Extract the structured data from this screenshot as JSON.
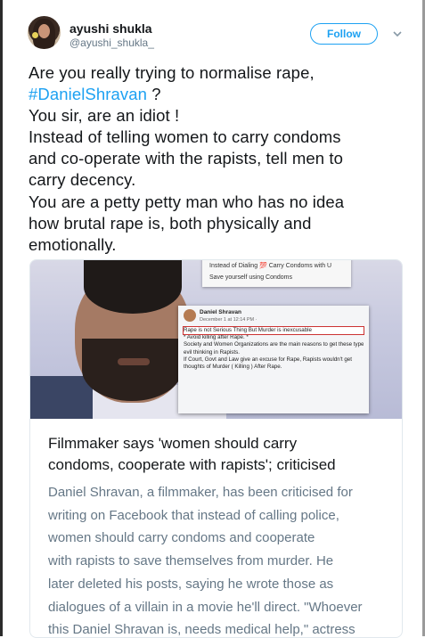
{
  "header": {
    "user_name": "ayushi shukla",
    "user_handle": "@ayushi_shukla_",
    "follow_label": "Follow",
    "menu_icon": "chevron-down-icon"
  },
  "tweet": {
    "lines": [
      "Are you really trying to normalise rape,",
      "#DanielShravan",
      " ?",
      "You sir, are an idiot !",
      "Instead of telling women to carry condoms",
      "and co-operate with the rapists, tell men to",
      "carry decency.",
      "You are a petty petty man who has no idea",
      "how brutal rape is, both physically and",
      "emotionally."
    ]
  },
  "card": {
    "image": {
      "top_lines": [
        "Instead of Dialing 💯 Carry Condoms with U",
        "Save yourself using Condoms"
      ],
      "fb_name": "Daniel Shravan",
      "fb_date": "December 1 at 12:14 PM · ",
      "fb_lines": [
        "Rape is not Serious Thing But Murder is inexcusable",
        "* Avoid killing after Rape. *",
        "Society and Women Organizations are the main reasons to get these type",
        "evil thinking in Rapists.",
        "If Court, Govt and Law give an excuse for Rape, Rapists wouldn't get",
        "thoughts of Murder ( Killing ) After Rape."
      ]
    },
    "title_lines": [
      "Filmmaker says 'women should carry",
      "condoms, cooperate with rapists'; criticised"
    ],
    "desc_lines": [
      "Daniel Shravan, a filmmaker, has been criticised for",
      "writing on Facebook that instead of calling police,",
      "women should carry condoms and cooperate",
      "with rapists to save themselves from murder. He",
      "later deleted his posts, saying he wrote those as",
      "dialogues of a villain in a movie he'll direct. \"Whoever",
      "this Daniel Shravan is, needs medical help,\" actress"
    ]
  },
  "colors": {
    "accent": "#1da1f2",
    "text": "#14171a",
    "muted": "#657786"
  }
}
